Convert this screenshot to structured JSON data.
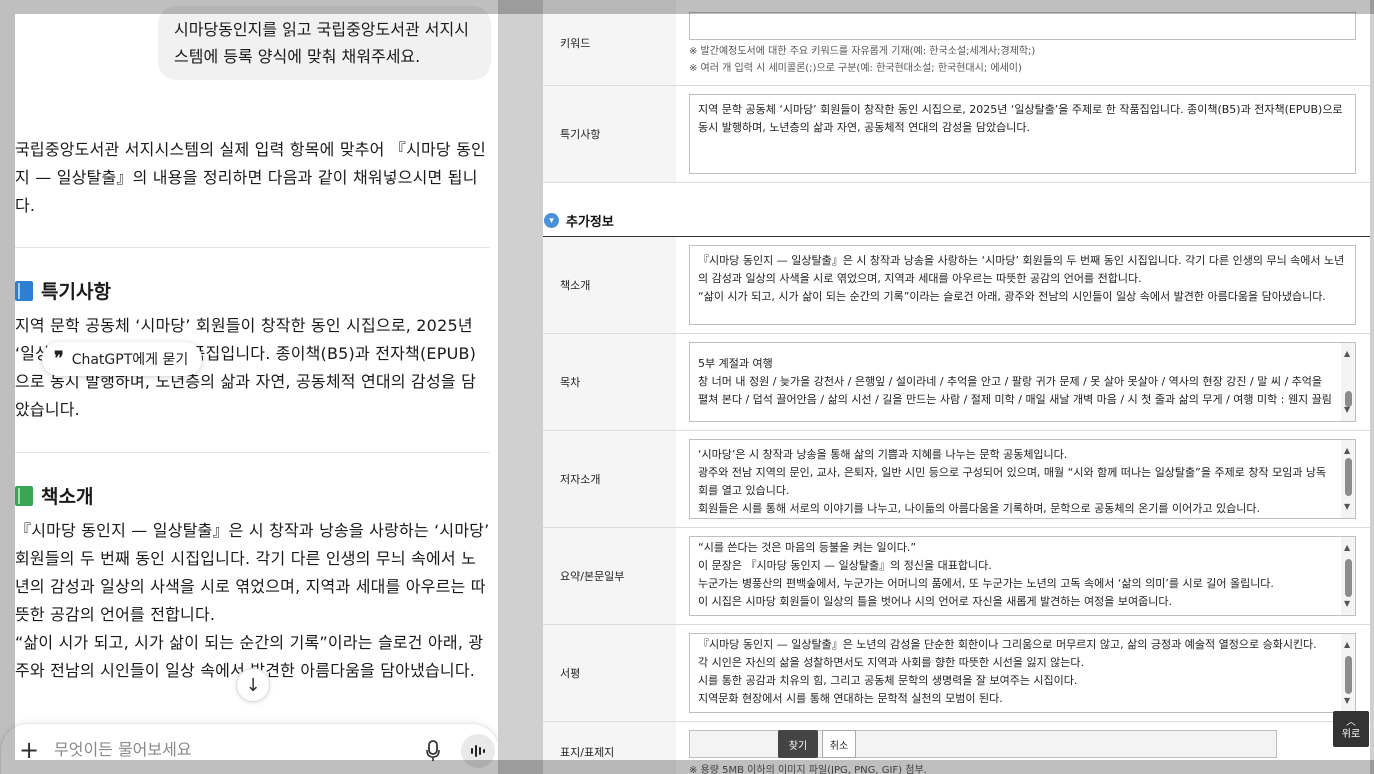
{
  "chat": {
    "user_message": "시마당동인지를 읽고 국립중앙도서관 서지시스템에 등록 양식에 맞춰 채워주세요.",
    "intro": "국립중앙도서관 서지시스템의 실제 입력 항목에 맞추어 『시마당 동인지 — 일상탈출』의 내용을 정리하면 다음과 같이 채워넣으시면 됩니다.",
    "section1_title": "특기사항",
    "section1_text": "지역 문학 공동체 ‘시마당’ 회원들이 창작한 동인 시집으로, 2025년 ‘일상탈출’을 주제로 한 작품집입니다. 종이책(B5)과 전자책(EPUB)으로 동시 발행하며, 노년층의 삶과 자연, 공동체적 연대의 감성을 담았습니다.",
    "section2_title": "책소개",
    "section2_text": "『시마당 동인지 — 일상탈출』은 시 창작과 낭송을 사랑하는 ‘시마당’ 회원들의 두 번째 동인 시집입니다. 각기 다른 인생의 무늬 속에서 노년의 감성과 일상의 사색을 시로 엮었으며, 지역과 세대를 아우르는 따뜻한 공감의 언어를 전합니다.\n“삶이 시가 되고, 시가 삶이 되는 순간의 기록”이라는 슬로건 아래, 광주와 전남의 시인들이 일상 속에서 발견한 아름다움을 담아냈습니다.",
    "ask_chip": "ChatGPT에게 묻기",
    "composer_placeholder": "무엇이든 물어보세요"
  },
  "form": {
    "keyword_label": "키워드",
    "keyword_value": "",
    "keyword_hint1": "※ 발간예정도서에 대한 주요 키워드를 자유롭게 기재(예: 한국소설;세계사;경제학;)",
    "keyword_hint2": "※ 여러 개 입력 시 세미콜론(;)으로 구분(예: 한국현대소설; 한국현대시; 에세이)",
    "special_label": "특기사항",
    "special_text": "지역 문학 공동체 ‘시마당’ 회원들이 창작한 동인 시집으로, 2025년 ‘일상탈출’을 주제로 한 작품집입니다. 종이책(B5)과 전자책(EPUB)으로 동시 발행하며, 노년층의 삶과 자연, 공동체적 연대의 감성을 담았습니다.",
    "extra_title": "추가정보",
    "intro_label": "책소개",
    "intro_line1": "『시마당 동인지 — 일상탈출』은 시 창작과 낭송을 사랑하는 ‘시마당’ 회원들의 두 번째 동인 시집입니다. 각기 다른 인생의 무늬 속에서 노년의 감성과 일상의 사색을 시로 엮었으며, 지역과 세대를 아우르는 따뜻한 공감의 언어를 전합니다.",
    "intro_line2": "“삶이 시가 되고, 시가 삶이 되는 순간의 기록”이라는 슬로건 아래, 광주와 전남의 시인들이 일상 속에서 발견한 아름다움을 담아냈습니다.",
    "toc_label": "목차",
    "toc_line1": "5부 계절과 여행",
    "toc_line2": "창 너머 내 정원 / 늦가을 강천사 / 은행잎 / 설이라네 / 추억을 안고 / 팔랑 귀가 문제 / 못 살아 못살아 / 역사의 현장 강진 / 말 씨 / 추억을 펼쳐 본다 / 덥석 끌어안음 / 삶의 시선 / 길을 만드는 사람 / 절제 미학 / 매일 새날 개벽 마음 / 시 첫 줄과 삶의 무게 / 여행 미학 : 웬지 끌림",
    "author_label": "저자소개",
    "author_line1": "‘시마당’은 시 창작과 낭송을 통해 삶의 기쁨과 지혜를 나누는 문학 공동체입니다.",
    "author_line2": "광주와 전남 지역의 문인, 교사, 은퇴자, 일반 시민 등으로 구성되어 있으며, 매월 “시와 함께 떠나는 일상탈출”을 주제로 창작 모임과 낭독회를 열고 있습니다.",
    "author_line3": "회원들은 시를 통해 서로의 이야기를 나누고, 나이듦의 아름다움을 기록하며, 문학으로 공동체의 온기를 이어가고 있습니다.",
    "summary_label": "요약/본문일부",
    "summary_line1": "“시를 쓴다는 것은 마음의 등불을 켜는 일이다.”",
    "summary_line2": "이 문장은 『시마당 동인지 — 일상탈출』의 정신을 대표합니다.",
    "summary_line3": "누군가는 병풍산의 편백숲에서, 누군가는 어머니의 품에서, 또 누군가는 노년의 고독 속에서 ‘삶의 의미’를 시로 길어 올립니다.",
    "summary_line4": "이 시집은 시마당 회원들이 일상의 틀을 벗어나 시의 언어로 자신을 새롭게 발견하는 여정을 보여줍니다.",
    "review_label": "서평",
    "review_line1": "『시마당 동인지 — 일상탈출』은 노년의 감성을 단순한 회한이나 그리움으로 머무르지 않고, 삶의 긍정과 예술적 열정으로 승화시킨다.",
    "review_line2": "각 시인은 자신의 삶을 성찰하면서도 지역과 사회를 향한 따뜻한 시선을 잃지 않는다.",
    "review_line3": "시를 통한 공감과 치유의 힘, 그리고 공동체 문학의 생명력을 잘 보여주는 시집이다.",
    "review_line4": "지역문화 현장에서 시를 통해 연대하는 문학적 실천의 모범이 된다.",
    "cover_label": "표지/표제지",
    "cover_hint": "※ 용량 5MB 이하의 이미지 파일(JPG, PNG, GIF) 첨부.",
    "find_button": "찾기",
    "cancel_button": "취소",
    "top_button": "위로"
  },
  "colors": {
    "accent_blue": "#4a90d9",
    "book_blue": "#2d7fd3",
    "book_green": "#3aa655"
  }
}
